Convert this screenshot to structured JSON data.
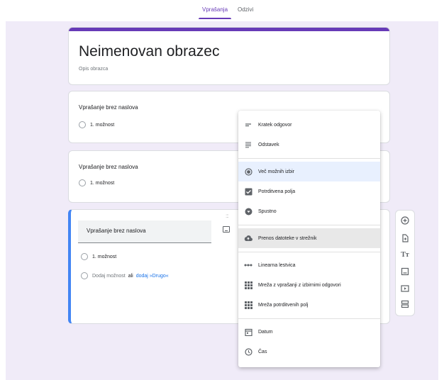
{
  "tabs": [
    {
      "label": "Vprašanja",
      "active": true
    },
    {
      "label": "Odzivi",
      "active": false
    }
  ],
  "form": {
    "title": "Neimenovan obrazec",
    "description": "Opis obrazca"
  },
  "questions": [
    {
      "title": "Vprašanje brez naslova",
      "option": "1. možnost"
    },
    {
      "title": "Vprašanje brez naslova",
      "option": "1. možnost"
    }
  ],
  "active_question": {
    "title": "Vprašanje brez naslova",
    "option": "1. možnost",
    "add_option": "Dodaj možnost",
    "or": "ali",
    "add_other": "dodaj »Drugo«"
  },
  "menu": {
    "items": [
      {
        "label": "Kratek odgovor",
        "icon": "short-text-icon"
      },
      {
        "label": "Odstavek",
        "icon": "paragraph-icon"
      },
      {
        "label": "Več možnih izbir",
        "icon": "radio-icon",
        "selected": true
      },
      {
        "label": "Potrditvena polja",
        "icon": "checkbox-icon"
      },
      {
        "label": "Spustno",
        "icon": "dropdown-icon"
      },
      {
        "label": "Prenos datoteke v strežnik",
        "icon": "cloud-upload-icon",
        "hovered": true
      },
      {
        "label": "Linearna lestvica",
        "icon": "linear-scale-icon"
      },
      {
        "label": "Mreža z vprašanji z izbirnimi odgovori",
        "icon": "grid-icon"
      },
      {
        "label": "Mreža potrditvenih polj",
        "icon": "grid-icon"
      },
      {
        "label": "Datum",
        "icon": "calendar-icon"
      },
      {
        "label": "Čas",
        "icon": "clock-icon"
      }
    ]
  },
  "toolbar": {
    "icons": [
      "add-question-icon",
      "import-questions-icon",
      "add-title-icon",
      "add-image-icon",
      "add-video-icon",
      "add-section-icon"
    ]
  },
  "colors": {
    "accent": "#673ab7",
    "focus_border": "#4285f4",
    "link": "#1a73e8",
    "background": "#f0ebf8"
  }
}
